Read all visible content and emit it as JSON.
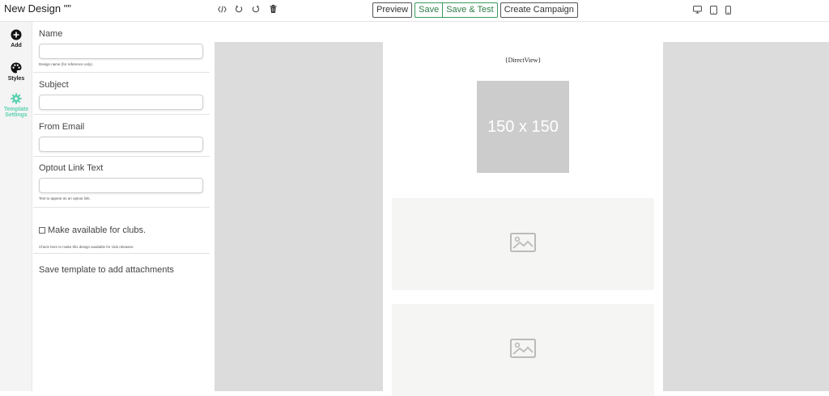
{
  "header": {
    "title": "New Design \"\"",
    "buttons": {
      "preview": "Preview",
      "save": "Save",
      "save_test": "Save & Test",
      "create_campaign": "Create Campaign"
    },
    "tool_icons": [
      "code-icon",
      "undo-icon",
      "redo-icon",
      "trash-icon"
    ],
    "device_icons": [
      "desktop-icon",
      "tablet-icon",
      "mobile-icon"
    ]
  },
  "rail": {
    "items": [
      {
        "label": "Add",
        "icon": "plus-circle-icon"
      },
      {
        "label": "Styles",
        "icon": "palette-icon"
      },
      {
        "label": "Template Settings",
        "icon": "gear-icon"
      }
    ],
    "active_color": "#5cd1b2"
  },
  "settings": {
    "name": {
      "label": "Name",
      "value": "",
      "hint": "Design name (for reference only)."
    },
    "subject": {
      "label": "Subject",
      "value": ""
    },
    "from_email": {
      "label": "From Email",
      "value": ""
    },
    "optout": {
      "label": "Optout Link Text",
      "value": "",
      "hint": "Text to appear as an optout link."
    },
    "clubs": {
      "label": "Make available for clubs.",
      "checked": false,
      "hint": "Check here to make this design available for club releases."
    },
    "attachments_note": "Save template to add attachments"
  },
  "canvas": {
    "brand_text": "{DirectView}",
    "placeholder_text": "150 x 150",
    "image_blocks": [
      "image-placeholder-icon",
      "image-placeholder-icon"
    ]
  }
}
